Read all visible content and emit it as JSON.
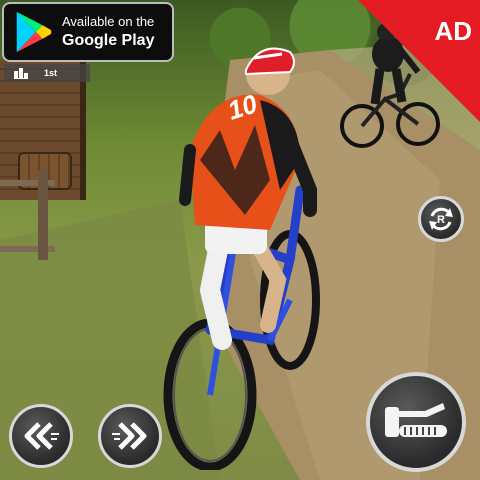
{
  "ad_badge": {
    "label": "AD",
    "color": "#e51b24"
  },
  "store_badge": {
    "line1": "Available on the",
    "line2": "Google Play",
    "icon": "google-play-icon"
  },
  "race_position": {
    "icon": "leaderboard-icon",
    "label": "1st"
  },
  "controls": {
    "reset": {
      "icon": "reset-icon",
      "letter": "R"
    },
    "steer_left": {
      "icon": "double-chevron-left-icon"
    },
    "steer_right": {
      "icon": "double-chevron-right-icon"
    },
    "accelerate": {
      "icon": "throttle-icon"
    }
  },
  "player": {
    "jersey_number": "10",
    "jersey_colors": [
      "#e8501a",
      "#1a1a1a"
    ]
  }
}
